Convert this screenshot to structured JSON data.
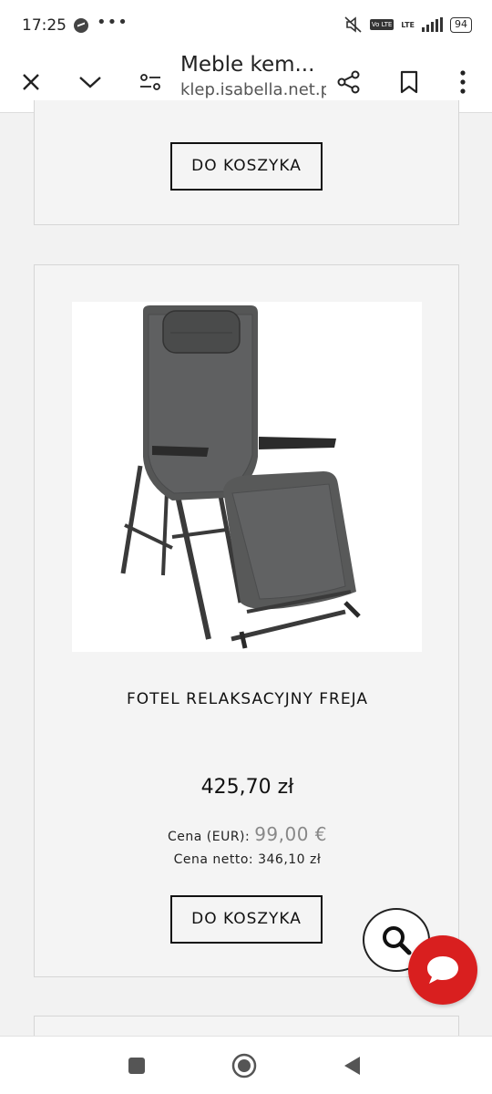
{
  "status_bar": {
    "time": "17:25",
    "app_icons": [
      "messenger-icon",
      "more-icon"
    ],
    "network": {
      "volte": "Vo LTE",
      "lte": "LTE"
    },
    "battery": "94"
  },
  "browser": {
    "page_title": "Meble kem...",
    "url": "klep.isabella.net.pl",
    "icons": [
      "close-icon",
      "chevron-down-icon",
      "site-settings-icon",
      "share-icon",
      "bookmark-icon",
      "kebab-menu-icon"
    ]
  },
  "cards": {
    "top": {
      "cart_label": "DO KOSZYKA"
    },
    "main": {
      "product_name": "FOTEL RELAKSACYJNY FREJA",
      "price": "425,70 zł",
      "price_eur_label": "Cena (EUR):",
      "price_eur_value": "99,00 €",
      "price_net": "Cena netto: 346,10 zł",
      "cart_label": "DO KOSZYKA"
    }
  },
  "floating": {
    "search_icon": "search-icon",
    "chat_icon": "chat-icon",
    "chat_color": "#d91f1f"
  },
  "nav_bar": {
    "icons": [
      "recents-icon",
      "home-icon",
      "back-icon"
    ]
  }
}
